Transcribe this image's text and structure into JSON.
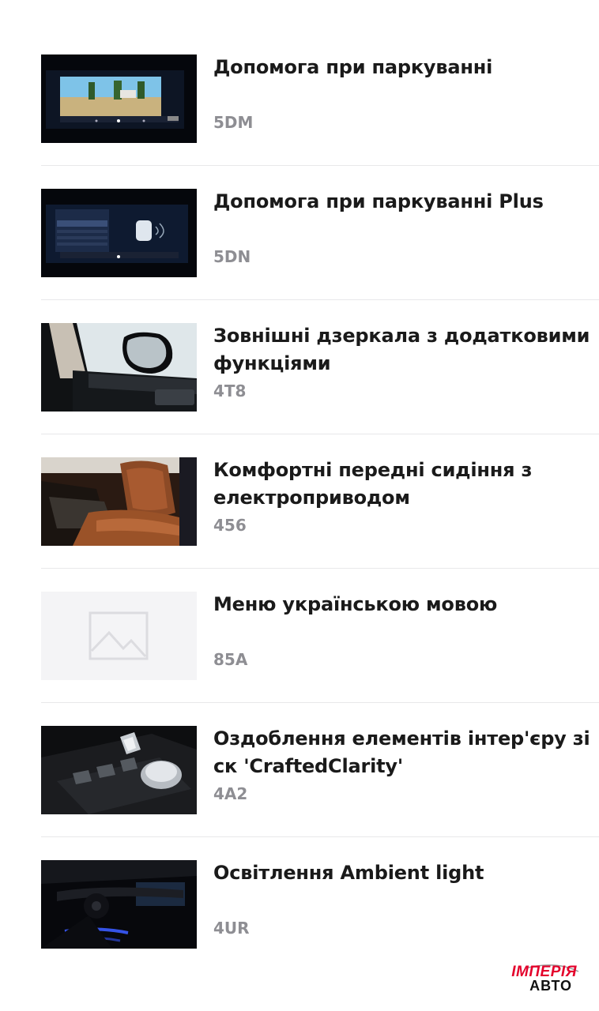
{
  "options": [
    {
      "title": "Допомога при паркуванні",
      "code": "5DM",
      "image": "parking-assist-screen"
    },
    {
      "title": "Допомога при паркуванні Plus",
      "code": "5DN",
      "image": "parking-assist-plus-screen"
    },
    {
      "title": "Зовнішні дзеркала з додатковими функціями",
      "code": "4T8",
      "image": "exterior-mirror-photo"
    },
    {
      "title": "Комфортні передні сидіння з електроприводом",
      "code": "456",
      "image": "leather-seat-photo"
    },
    {
      "title": "Меню українською мовою",
      "code": "85A",
      "image": "image-placeholder-icon"
    },
    {
      "title": "Оздоблення елементів інтер'єру зі ск 'CraftedClarity'",
      "code": "4A2",
      "image": "crystal-controls-photo"
    },
    {
      "title": "Освітлення Ambient light",
      "code": "4UR",
      "image": "ambient-light-photo"
    }
  ],
  "watermark": {
    "top": "ІМПЕРІЯ",
    "bottom": "АВТО",
    "color": "#e4002b"
  }
}
